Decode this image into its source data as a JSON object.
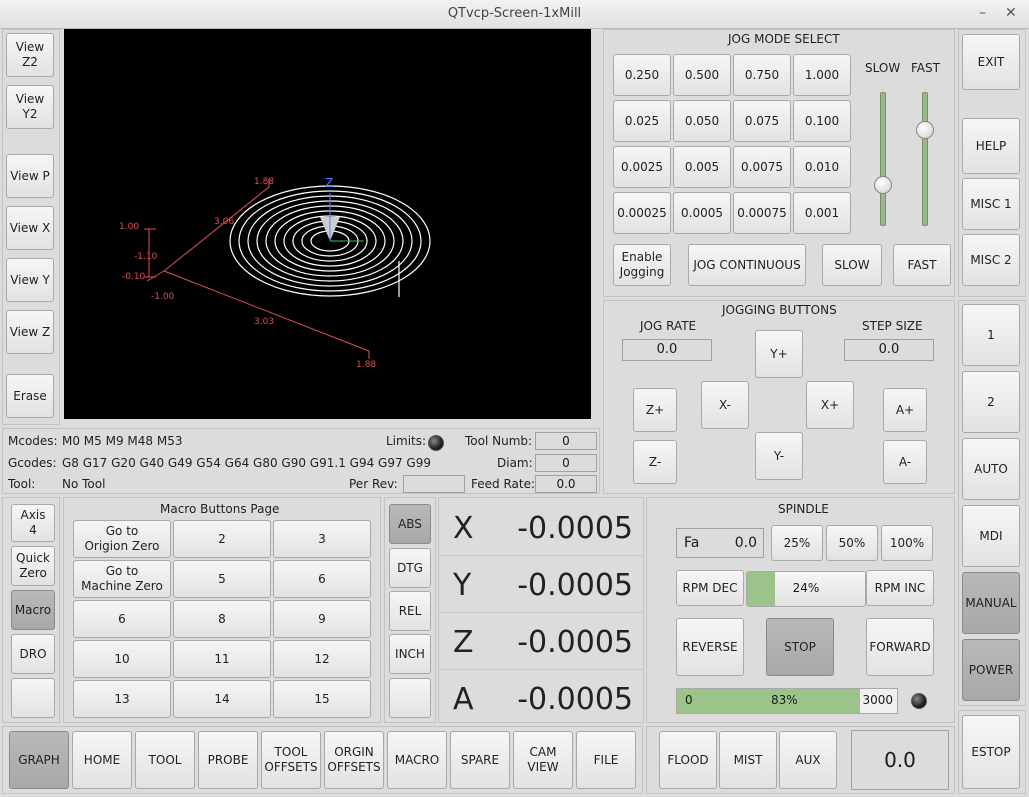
{
  "window": {
    "title": "QTvcp-Screen-1xMill",
    "minimize": "–",
    "close": "✕"
  },
  "view_buttons": [
    "View Z2",
    "View Y2",
    "View P",
    "View X",
    "View Y",
    "View Z",
    "Erase"
  ],
  "graph": {
    "axis_label": "Z",
    "dims": [
      "1.00",
      "-1.10",
      "-0.10",
      "-1.00",
      "3.06",
      "3.03",
      "1.88",
      "1.88"
    ]
  },
  "jog_mode": {
    "title": "JOG MODE SELECT",
    "increments": [
      "0.250",
      "0.500",
      "0.750",
      "1.000",
      "0.025",
      "0.050",
      "0.075",
      "0.100",
      "0.0025",
      "0.005",
      "0.0075",
      "0.010",
      "0.00025",
      "0.0005",
      "0.00075",
      "0.001"
    ],
    "slow_label": "SLOW",
    "fast_label": "FAST",
    "enable_jogging": "Enable\nJogging",
    "jog_continuous": "JOG CONTINUOUS",
    "slow": "SLOW",
    "fast": "FAST",
    "slow_slider": 0.28,
    "fast_slider": 0.75
  },
  "right_col": {
    "exit": "EXIT",
    "help": "HELP",
    "misc1": "MISC 1",
    "misc2": "MISC 2",
    "one": "1",
    "two": "2",
    "auto": "AUTO",
    "mdi": "MDI",
    "manual": "MANUAL",
    "power": "POWER",
    "estop": "ESTOP"
  },
  "jogging": {
    "title": "JOGGING  BUTTONS",
    "jog_rate_label": "JOG RATE",
    "jog_rate": "0.0",
    "step_size_label": "STEP SIZE",
    "step_size": "0.0",
    "yplus": "Y+",
    "yminus": "Y-",
    "xplus": "X+",
    "xminus": "X-",
    "zplus": "Z+",
    "zminus": "Z-",
    "aplus": "A+",
    "aminus": "A-"
  },
  "status": {
    "mcodes_label": "Mcodes:",
    "mcodes": "M0 M5 M9 M48 M53",
    "gcodes_label": "Gcodes:",
    "gcodes": "G8 G17 G20 G40 G49 G54 G64 G80 G90 G91.1 G94 G97 G99",
    "tool_label": "Tool:",
    "tool": "No Tool",
    "limits_label": "Limits:",
    "tool_numb_label": "Tool Numb:",
    "tool_numb": "0",
    "diam_label": "Diam:",
    "diam": "0",
    "per_rev_label": "Per Rev:",
    "per_rev": "",
    "feed_rate_label": "Feed Rate:",
    "feed_rate": "0.0"
  },
  "left_tabs": [
    "Axis\n4",
    "Quick\nZero",
    "Macro",
    "DRO",
    ""
  ],
  "macro": {
    "title": "Macro Buttons Page",
    "buttons": [
      "Go to\nOrigion Zero",
      "2",
      "3",
      "Go to\nMachine Zero",
      "5",
      "6",
      "6",
      "8",
      "9",
      "10",
      "11",
      "12",
      "13",
      "14",
      "15"
    ]
  },
  "dro_modes": [
    "ABS",
    "DTG",
    "REL",
    "INCH",
    ""
  ],
  "dro": [
    {
      "axis": "X",
      "value": "-0.0005"
    },
    {
      "axis": "Y",
      "value": "-0.0005"
    },
    {
      "axis": "Z",
      "value": "-0.0005"
    },
    {
      "axis": "A",
      "value": "-0.0005"
    }
  ],
  "spindle": {
    "title": "SPINDLE",
    "fa_label": "Fa",
    "fa_value": "0.0",
    "p25": "25%",
    "p50": "50%",
    "p100": "100%",
    "rpm_dec": "RPM DEC",
    "rpm_inc": "RPM INC",
    "rpm_pct": "24%",
    "rpm_fill": 0.24,
    "reverse": "REVERSE",
    "stop": "STOP",
    "forward": "FORWARD",
    "bar_min": "0",
    "bar_pct": "83%",
    "bar_fill": 0.83,
    "bar_max": "3000"
  },
  "bottom_tabs": [
    "GRAPH",
    "HOME",
    "TOOL",
    "PROBE",
    "TOOL\nOFFSETS",
    "ORGIN\nOFFSETS",
    "MACRO",
    "SPARE",
    "CAM\nVIEW",
    "FILE"
  ],
  "coolant": {
    "flood": "FLOOD",
    "mist": "MIST",
    "aux": "AUX",
    "readout": "0.0"
  },
  "colors": {
    "accent_fill": "#9cc38a",
    "graph_bg": "#000000",
    "toolpath": "#ffffff",
    "dims": "#e05050"
  }
}
